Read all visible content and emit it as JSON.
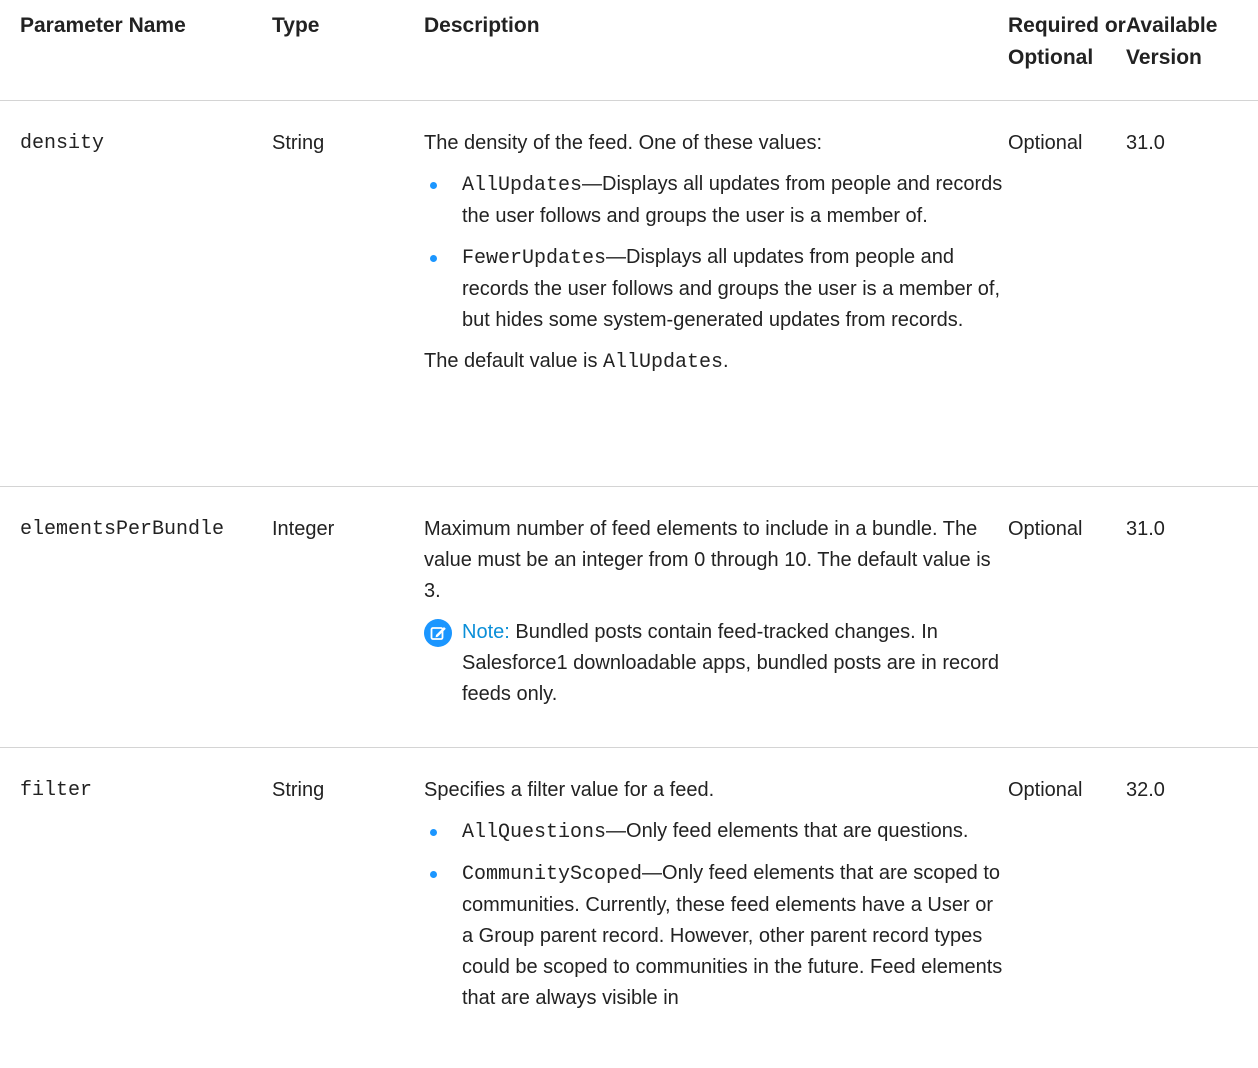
{
  "headers": {
    "name": "Parameter Name",
    "type": "Type",
    "description": "Description",
    "required": "Required or Optional",
    "version": "Available Version"
  },
  "rows": [
    {
      "name": "density",
      "type": "String",
      "intro": "The density of the feed. One of these values:",
      "items": [
        {
          "code": "AllUpdates",
          "text": "—Displays all updates from people and records the user follows and groups the user is a member of."
        },
        {
          "code": "FewerUpdates",
          "text": "—Displays all updates from people and records the user follows and groups the user is a member of, but hides some system-generated updates from records."
        }
      ],
      "after_prefix": "The default value is ",
      "after_code": "AllUpdates",
      "after_suffix": ".",
      "required": "Optional",
      "version": "31.0"
    },
    {
      "name": "elementsPerBundle",
      "type": "Integer",
      "intro": "Maximum number of feed elements to include in a bundle. The value must be an integer from 0 through 10. The default value is 3.",
      "note_label": "Note:",
      "note_text": " Bundled posts contain feed-tracked changes. In Salesforce1 downloadable apps, bundled posts are in record feeds only.",
      "required": "Optional",
      "version": "31.0"
    },
    {
      "name": "filter",
      "type": "String",
      "intro": "Specifies a filter value for a feed.",
      "items": [
        {
          "code": "AllQuestions",
          "text": "—Only feed elements that are questions."
        },
        {
          "code": "CommunityScoped",
          "text": "—Only feed elements that are scoped to communities. Currently, these feed elements have a User or a Group parent record. However, other parent record types could be scoped to communities in the future. Feed elements that are always visible in"
        }
      ],
      "required": "Optional",
      "version": "32.0"
    }
  ],
  "colors": {
    "bullet": "#1b96ff",
    "note_accent": "#0b8fd8",
    "divider": "#d4d4d4"
  },
  "icons": {
    "bullet": "bullet-dot-icon",
    "note": "edit-note-icon"
  }
}
